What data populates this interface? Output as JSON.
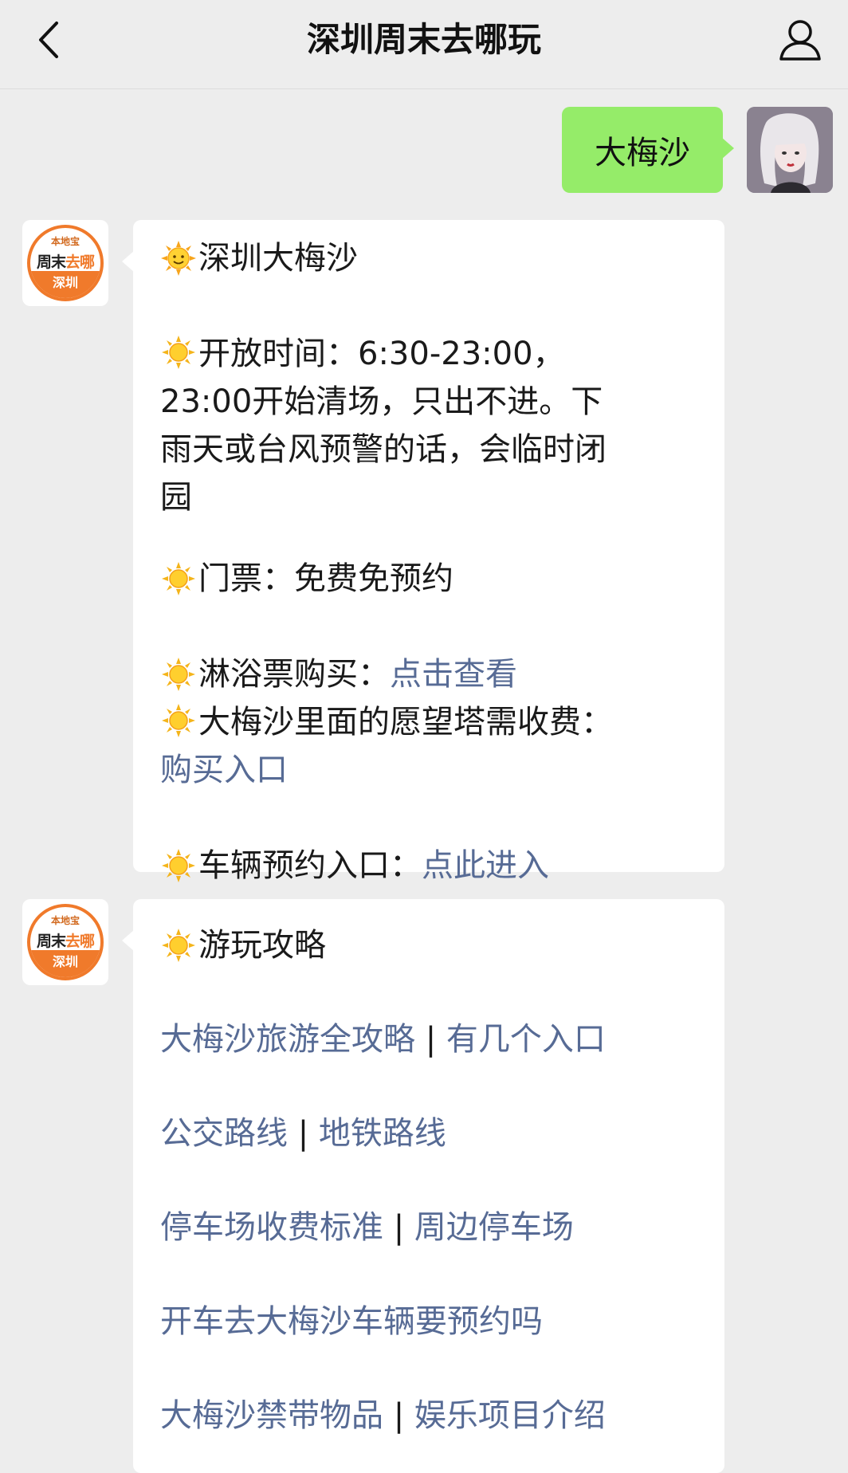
{
  "header": {
    "title": "深圳周末去哪玩",
    "back_icon": "chevron-left-icon",
    "profile_icon": "user-icon"
  },
  "messages": {
    "user_query": "大梅沙",
    "bot_avatar": {
      "top": "本地宝",
      "middle_dark": "周末",
      "middle_orange": "去哪",
      "bottom": "深圳"
    },
    "reply1": {
      "title": "深圳大梅沙",
      "hours_label": "开放时间：6:30-23:00，23:00开始清场，只出不进。下雨天或台风预警的话，会临时闭园",
      "ticket": "门票：免费免预约",
      "shower_label": "淋浴票购买：",
      "shower_link": "点击查看",
      "tower_label": "大梅沙里面的愿望塔需收费：",
      "tower_link": "购买入口",
      "car_label": "车辆预约入口：",
      "car_link": "点此进入"
    },
    "reply2": {
      "title": "游玩攻略",
      "links": [
        {
          "a": "大梅沙旅游全攻略",
          "b": "有几个入口"
        },
        {
          "a": "公交路线",
          "b": "地铁路线"
        },
        {
          "a": "停车场收费标准",
          "b": "周边停车场"
        },
        {
          "a": "开车去大梅沙车辆要预约吗",
          "b": ""
        },
        {
          "a": "大梅沙禁带物品",
          "b": "娱乐项目介绍"
        }
      ],
      "separator": " | "
    }
  },
  "colors": {
    "background": "#ededed",
    "user_bubble": "#95ec69",
    "link": "#576b95",
    "brand_orange": "#f07a2b"
  }
}
